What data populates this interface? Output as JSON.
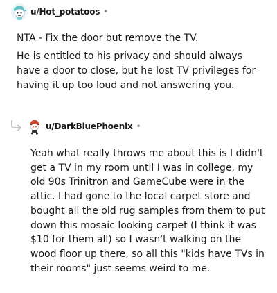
{
  "comments": [
    {
      "username": "u/Hot_potatoos",
      "separator": "•",
      "avatar": "snoo-avatar-teal-hair",
      "paragraphs": [
        "NTA - Fix the door but remove the TV.",
        "He is entitled to his privacy and should always have a door to close, but he lost TV privileges for having it up too loud and not answering you."
      ]
    },
    {
      "username": "u/DarkBluePhoenix",
      "separator": "•",
      "avatar": "snoo-avatar-red-cap",
      "reply_icon": "reply-arrow-icon",
      "paragraphs": [
        "Yeah what really throws me about this is I didn't get a TV in my room until I was in college, my old 90s Trinitron and GameCube were in the attic. I had gone to the local carpet store and bought all the old rug samples from them to put down this mosaic looking carpet (I think it was $10 for them all) so I wasn't walking on the wood floor up there, so all this \"kids have TVs in their rooms\" just seems weird to me."
      ]
    }
  ],
  "colors": {
    "text": "#1a1a1b",
    "meta": "#878a8c",
    "reply_arrow": "#c4c6c8"
  }
}
